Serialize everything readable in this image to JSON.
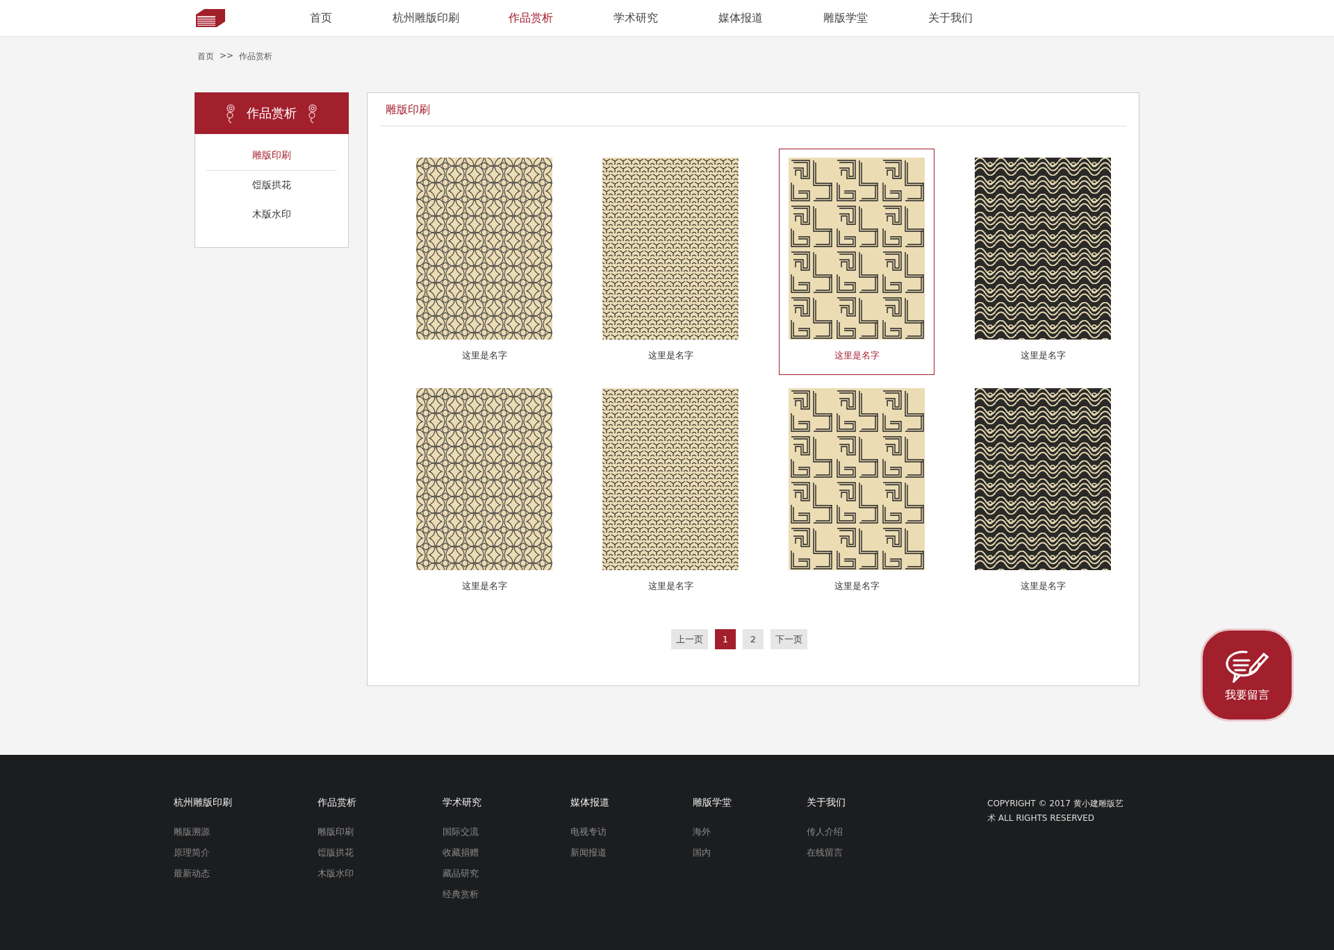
{
  "nav": [
    {
      "label": "首页",
      "selected": false
    },
    {
      "label": "杭州雕版印刷",
      "selected": false
    },
    {
      "label": "作品赏析",
      "selected": true
    },
    {
      "label": "学术研究",
      "selected": false
    },
    {
      "label": "媒体报道",
      "selected": false
    },
    {
      "label": "雕版学堂",
      "selected": false
    },
    {
      "label": "关于我们",
      "selected": false
    }
  ],
  "breadcrumb": {
    "home": "首页",
    "separator": ">>",
    "current": "作品赏析"
  },
  "sidebar": {
    "title": "作品赏析",
    "items": [
      {
        "label": "雕版印刷",
        "selected": true
      },
      {
        "label": "饾版拱花",
        "selected": false
      },
      {
        "label": "木版水印",
        "selected": false
      }
    ]
  },
  "panel": {
    "title": "雕版印刷"
  },
  "works": [
    {
      "kind": "rings",
      "caption": "这里是名字",
      "selected": false
    },
    {
      "kind": "tripod",
      "caption": "这里是名字",
      "selected": false
    },
    {
      "kind": "fret",
      "caption": "这里是名字",
      "selected": true
    },
    {
      "kind": "swirl",
      "caption": "这里是名字",
      "selected": false
    },
    {
      "kind": "rings",
      "caption": "这里是名字",
      "selected": false
    },
    {
      "kind": "tripod",
      "caption": "这里是名字",
      "selected": false
    },
    {
      "kind": "fret",
      "caption": "这里是名字",
      "selected": false
    },
    {
      "kind": "swirl",
      "caption": "这里是名字",
      "selected": false
    }
  ],
  "pagination": {
    "prev": "上一页",
    "pages": [
      {
        "label": "1",
        "selected": true
      },
      {
        "label": "2",
        "selected": false
      }
    ],
    "next": "下一页"
  },
  "message_button": {
    "label": "我要留言"
  },
  "footer": {
    "columns": [
      {
        "heading": "杭州雕版印刷",
        "links": [
          "雕版溯源",
          "原理简介",
          "最新动态"
        ]
      },
      {
        "heading": "作品赏析",
        "links": [
          "雕版印刷",
          "饾版拱花",
          "木版水印"
        ]
      },
      {
        "heading": "学术研究",
        "links": [
          "国际交流",
          "收藏捐赠",
          "藏品研究",
          "经典赏析"
        ]
      },
      {
        "heading": "媒体报道",
        "links": [
          "电视专访",
          "新闻报道"
        ]
      },
      {
        "heading": "雕版学堂",
        "links": [
          "海外",
          "国内"
        ]
      },
      {
        "heading": "关于我们",
        "links": [
          "传人介绍",
          "在线留言"
        ]
      }
    ],
    "copyright": "COPYRIGHT © 2017 黄小建雕版艺术 ALL RIGHTS RESERVED"
  }
}
